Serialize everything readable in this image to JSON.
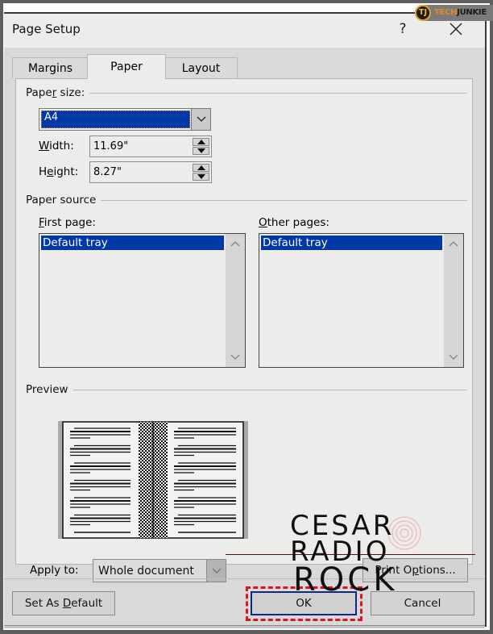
{
  "window": {
    "title": "Page Setup",
    "help_label": "?",
    "close_icon": "close-x-icon"
  },
  "badge": {
    "logo_text": "TJ",
    "brand_part1": "TECH",
    "brand_part2": "JUNKIE"
  },
  "tabs": [
    {
      "label": "Margins",
      "active": false
    },
    {
      "label": "Paper",
      "active": true
    },
    {
      "label": "Layout",
      "active": false
    }
  ],
  "paper_size": {
    "group_label_pre": "Pape",
    "group_label_accel": "r",
    "group_label_post": " size:",
    "selected": "A4",
    "width_label_accel": "W",
    "width_label_rest": "idth:",
    "width_value": "11.69\"",
    "height_label_pre": "H",
    "height_label_accel": "e",
    "height_label_rest": "ight:",
    "height_value": "8.27\""
  },
  "paper_source": {
    "group_label": "Paper source",
    "first_page_accel": "F",
    "first_page_rest": "irst page:",
    "first_page_items": [
      "Default tray"
    ],
    "other_pages_accel": "O",
    "other_pages_rest": "ther pages:",
    "other_pages_items": [
      "Default tray"
    ]
  },
  "preview": {
    "group_label": "Preview"
  },
  "apply_to": {
    "label": "Apply to:",
    "value": "Whole document"
  },
  "buttons": {
    "print_options_pre": "Print O",
    "print_options_accel": "p",
    "print_options_post": "tions...",
    "set_default_pre": "Set As ",
    "set_default_accel": "D",
    "set_default_post": "efault",
    "ok": "OK",
    "cancel": "Cancel"
  },
  "watermark": {
    "line1": "CESAR",
    "line2": "RADIO",
    "line3": "ROCK"
  },
  "colors": {
    "selection": "#0038a8",
    "highlight_dash": "#e0121c",
    "ok_border": "#0a2a8a"
  }
}
